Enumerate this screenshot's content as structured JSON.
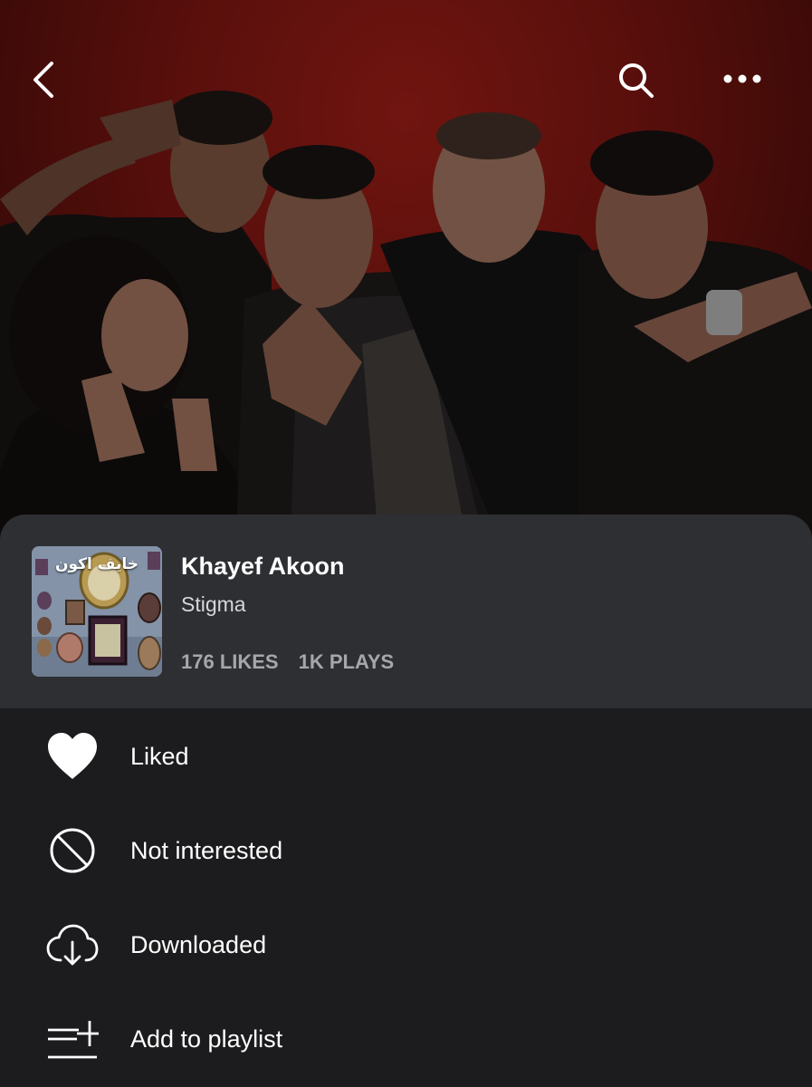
{
  "header": {
    "back_icon": "chevron-left-icon",
    "search_icon": "search-icon",
    "more_icon": "more-horizontal-icon"
  },
  "track": {
    "artwork_text": "خايف اكون",
    "title": "Khayef Akoon",
    "artist": "Stigma",
    "likes": "176 LIKES",
    "plays": "1K PLAYS"
  },
  "menu": {
    "items": [
      {
        "label": "Liked",
        "icon": "heart-filled-icon"
      },
      {
        "label": "Not interested",
        "icon": "block-icon"
      },
      {
        "label": "Downloaded",
        "icon": "cloud-download-icon"
      },
      {
        "label": "Add to playlist",
        "icon": "add-to-playlist-icon"
      }
    ]
  },
  "colors": {
    "hero_red": "#7a1510",
    "card_bg": "#2e2f33",
    "menu_bg": "#1c1c1e",
    "stats_text": "#a6a7ab"
  }
}
